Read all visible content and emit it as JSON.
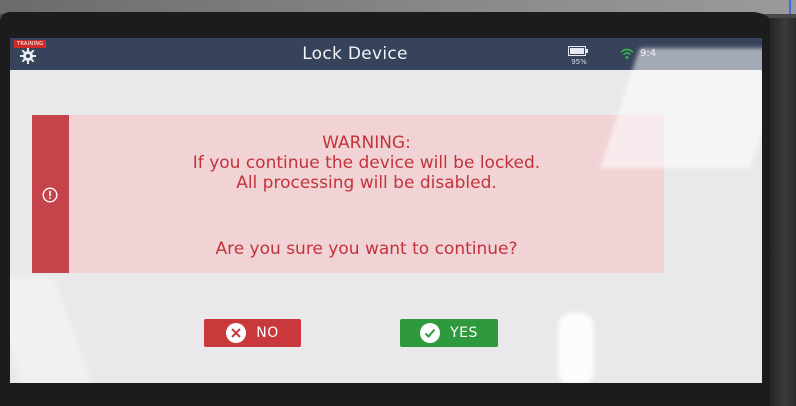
{
  "header": {
    "training_badge": "TRAINING",
    "title": "Lock Device",
    "battery_percent": "95%",
    "clock": "9:4",
    "settings_icon": "gear-icon",
    "battery_icon": "battery-icon",
    "wifi_icon": "wifi-icon"
  },
  "warning": {
    "heading": "WARNING:",
    "line1": "If you continue the device will be locked.",
    "line2": "All processing will be disabled.",
    "question": "Are you sure you want to continue?",
    "icon": "alert-circle-icon"
  },
  "buttons": {
    "no_label": "NO",
    "yes_label": "YES",
    "no_icon": "close-circle-icon",
    "yes_icon": "check-circle-icon"
  },
  "colors": {
    "header_bg": "#36435a",
    "warning_stripe": "#c5434a",
    "warning_bg": "#f1d3d6",
    "warning_text": "#c2333b",
    "no_button": "#c9393c",
    "yes_button": "#2e9a3d",
    "screen_bg": "#e9e9ec"
  }
}
